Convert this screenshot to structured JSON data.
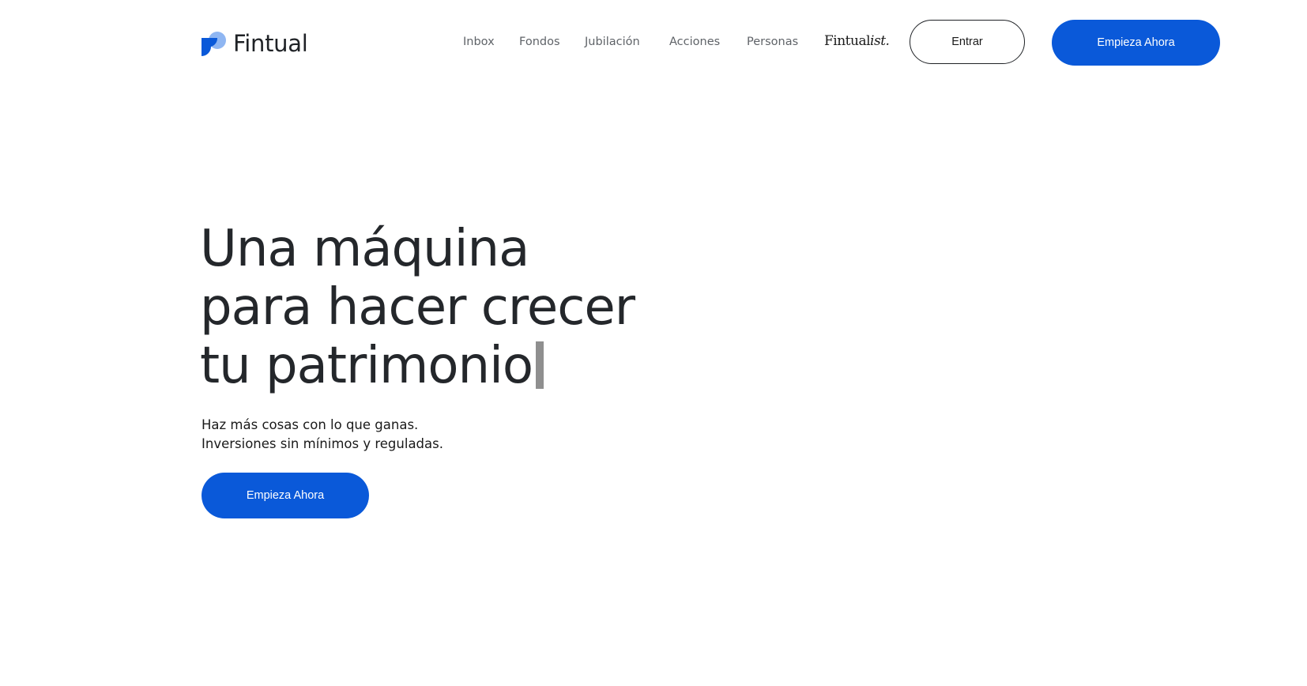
{
  "header": {
    "logo_text": "Fintual",
    "nav": {
      "inbox": "Inbox",
      "fondos": "Fondos",
      "jubilacion": "Jubilación",
      "acciones": "Acciones",
      "personas": "Personas",
      "fintualist_regular": "Fintual",
      "fintualist_italic": "ist."
    },
    "login_label": "Entrar",
    "cta_label": "Empieza Ahora"
  },
  "hero": {
    "title_lines": [
      "Una máquina",
      "para hacer crecer",
      "tu patrimonio"
    ],
    "subtitle_lines": [
      "Haz más cosas con lo que ganas.",
      "Inversiones sin mínimos y reguladas."
    ],
    "cta_label": "Empieza Ahora"
  },
  "colors": {
    "brand_blue": "#0a59d9",
    "logo_light_blue": "#8fb6f2",
    "text_dark": "#24272b",
    "nav_gray": "#5f6368"
  },
  "icons": {
    "logo": "fintual-logo-icon",
    "text_cursor": "text-cursor-icon"
  }
}
